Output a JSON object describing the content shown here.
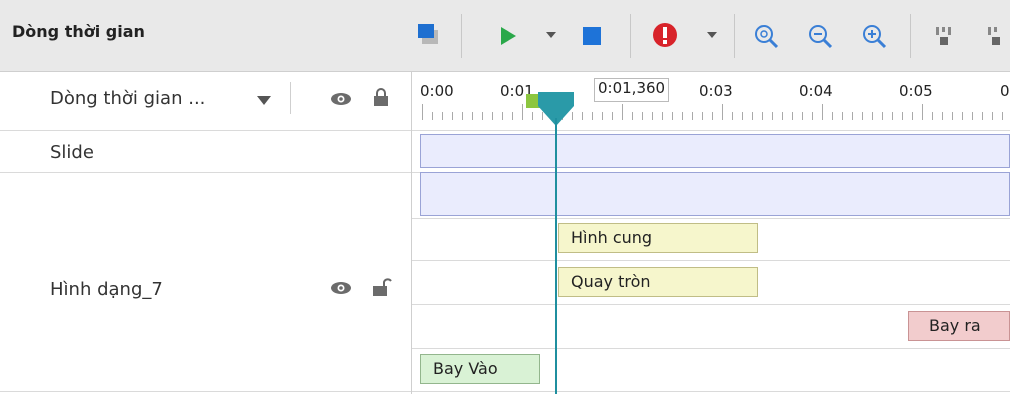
{
  "toolbar": {
    "title": "Dòng thời gian",
    "icons": [
      "layer-color-icon",
      "play-icon",
      "dropdown-arrow-icon",
      "stop-icon",
      "alert-icon",
      "dropdown-arrow-icon",
      "zoom-fit-icon",
      "zoom-out-icon",
      "zoom-in-icon",
      "align-icon",
      "align-icon-2"
    ],
    "colors": {
      "play": "#2aa84a",
      "stop": "#1e73d8",
      "alert": "#d8232a",
      "zoom": "#3a7fd6"
    }
  },
  "header": {
    "dropdown_label": "Dòng thời gian ...",
    "current_time": "0:01,360"
  },
  "ruler": {
    "labels": [
      "0:00",
      "0:01",
      "0:03",
      "0:04",
      "0:05",
      "0"
    ]
  },
  "tracks": [
    {
      "name": "Slide"
    },
    {
      "name": "Hình dạng_7"
    }
  ],
  "animations": {
    "arc": "Hình cung",
    "spin": "Quay tròn",
    "fly_out": "Bay ra",
    "fly_in": "Bay Vào"
  },
  "colors": {
    "playhead": "#1f8f9f",
    "slide_bar": "#eaecfd",
    "bar_yellow": "#f6f6cc",
    "bar_green": "#d9f2d5",
    "bar_red": "#f2cccd"
  }
}
